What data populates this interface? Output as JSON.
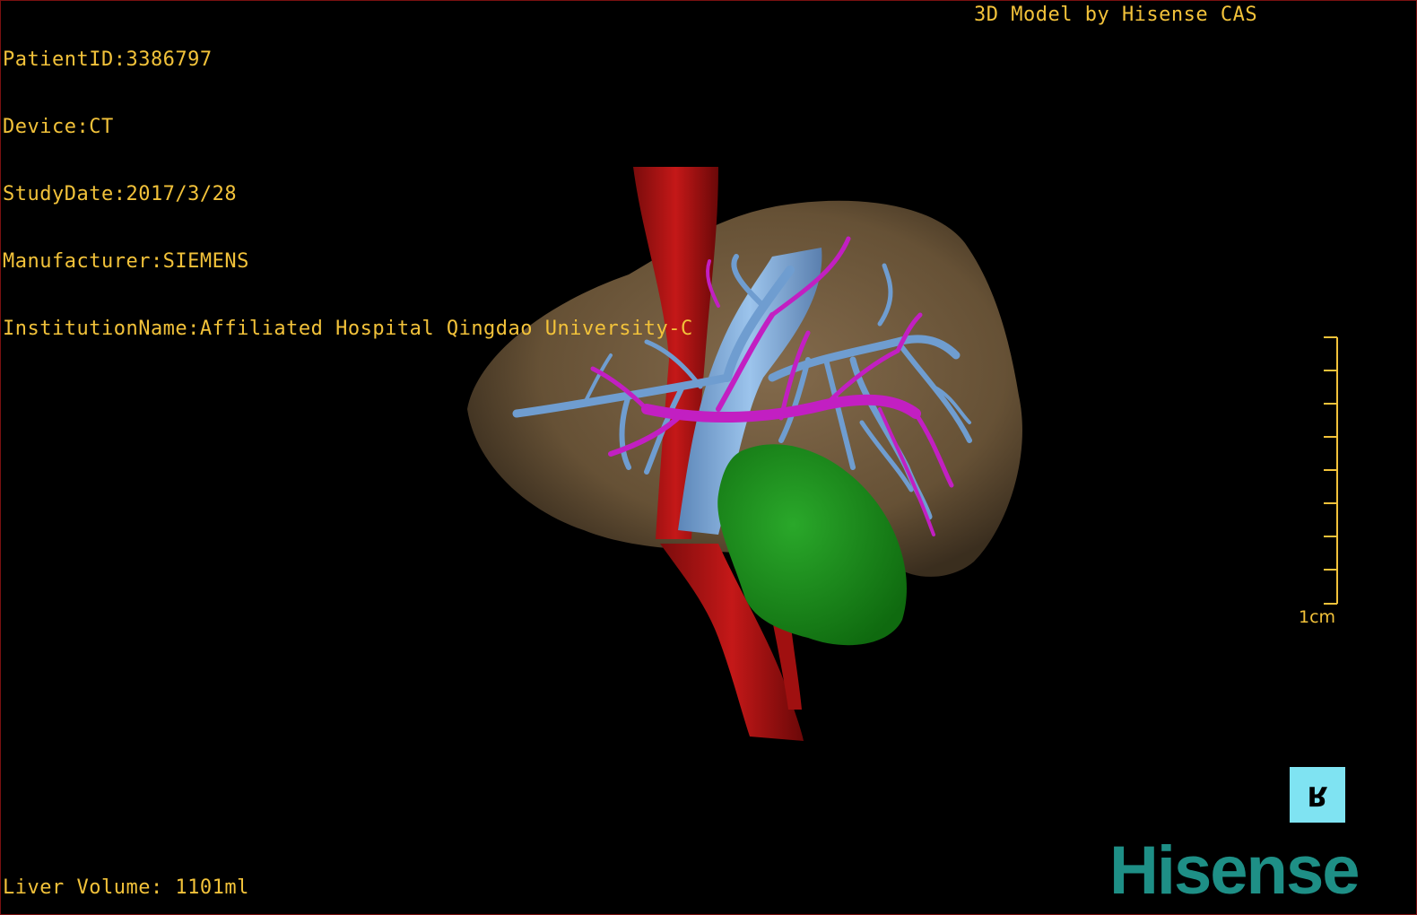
{
  "patient_info": {
    "patient_id": "PatientID:3386797",
    "device": "Device:CT",
    "study_date": "StudyDate:2017/3/28",
    "manufacturer": "Manufacturer:SIEMENS",
    "institution": "InstitutionName:Affiliated Hospital Qingdao University-C"
  },
  "model_credit": "3D Model by Hisense CAS",
  "liver_volume": "Liver Volume: 1101ml",
  "scale": {
    "label": "1cm"
  },
  "orientation_cube": {
    "label": "R"
  },
  "brand": {
    "logo_text": "Hisense"
  },
  "colors": {
    "overlay_text": "#f2c23a",
    "liver": "#7a6244",
    "aorta": "#b31414",
    "portal_vein": "#7aa7d6",
    "hepatic_artery": "#c21fc2",
    "tumor": "#1e8c1e",
    "orientation_cube": "#7fe3f2",
    "brand": "#1e8f86"
  }
}
